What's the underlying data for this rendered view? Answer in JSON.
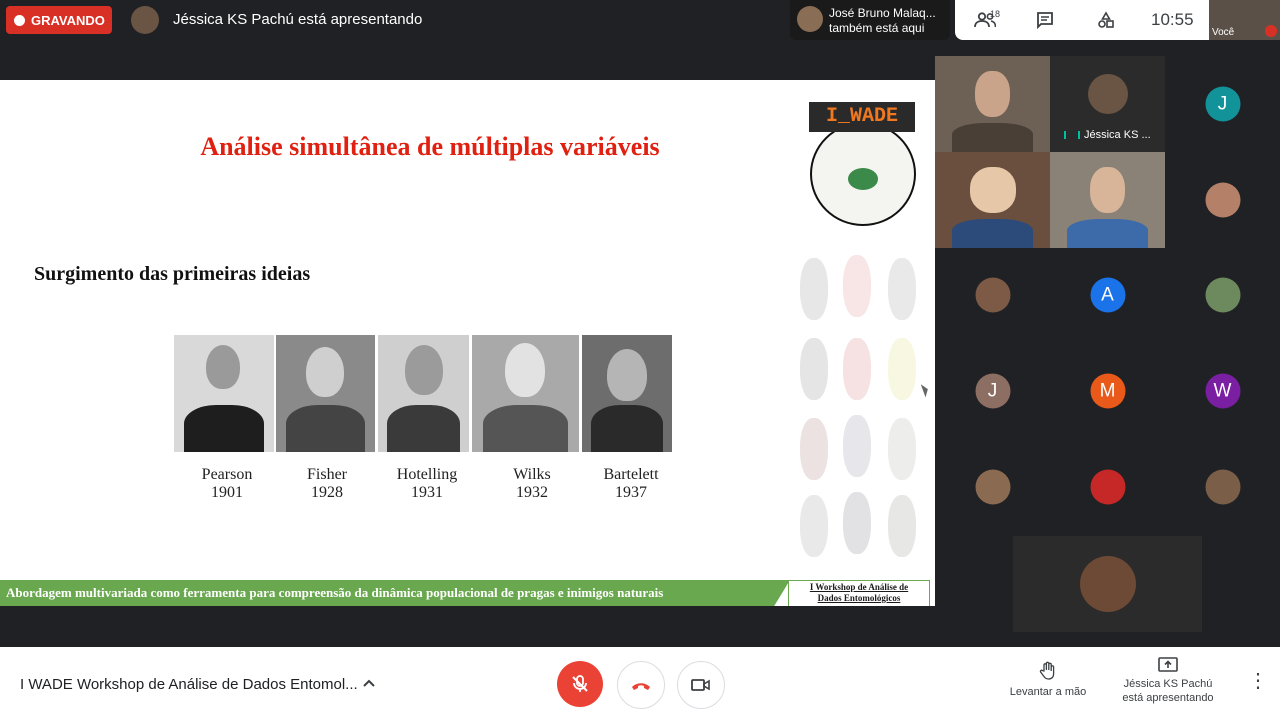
{
  "top_bar": {
    "recording_label": "GRAVANDO",
    "presenting_text": "Jéssica KS Pachú está apresentando",
    "also_here_line1": "José Bruno Malaq...",
    "also_here_line2": "também está aqui",
    "people_count": "18",
    "clock": "10:55",
    "self_label": "Você"
  },
  "slide": {
    "title": "Análise simultânea de múltiplas variáveis",
    "logo_text": "I_WADE",
    "subtitle": "Surgimento das primeiras ideias",
    "people": [
      {
        "name": "Pearson",
        "year": "1901"
      },
      {
        "name": "Fisher",
        "year": "1928"
      },
      {
        "name": "Hotelling",
        "year": "1931"
      },
      {
        "name": "Wilks",
        "year": "1932"
      },
      {
        "name": "Bartelett",
        "year": "1937"
      }
    ],
    "banner_text": "Abordagem multivariada como ferramenta para compreensão da dinâmica populacional de pragas e inimigos naturais",
    "banner_tag_line1": "I Workshop de Análise de",
    "banner_tag_line2": "Dados Entomológicos"
  },
  "participants": {
    "speaking_name": "Jéssica KS ...",
    "letters": [
      "J",
      "A",
      "J",
      "M",
      "W"
    ],
    "colors": {
      "teal": "#12939a",
      "blue": "#1a73e8",
      "brown": "#8d6e63",
      "orange": "#e8591a",
      "purple": "#7b1fa2"
    }
  },
  "bottom_bar": {
    "meeting_title": "I WADE Workshop de Análise de Dados Entomol...",
    "raise_hand_label": "Levantar a mão",
    "present_line1": "Jéssica KS Pachú",
    "present_line2": "está apresentando"
  }
}
